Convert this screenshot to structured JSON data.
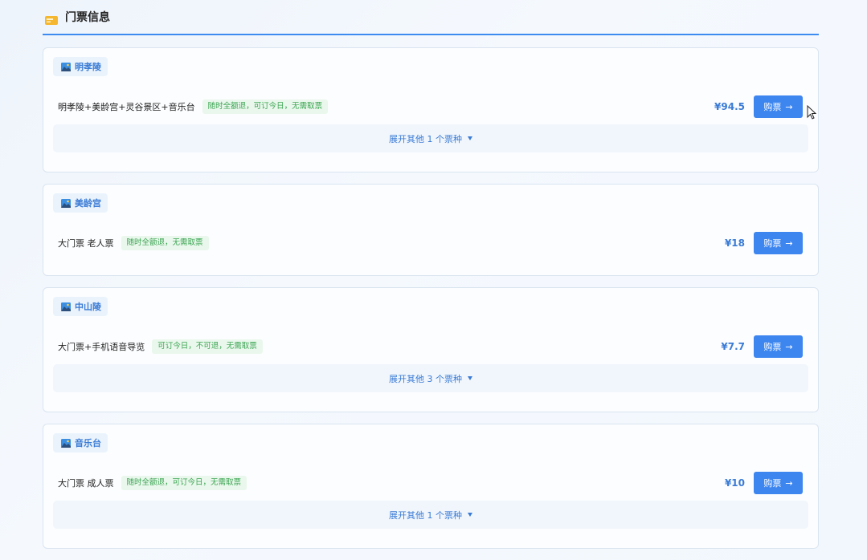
{
  "section": {
    "title": "门票信息",
    "icon": "ticket-icon",
    "accent": "#3d8bf0"
  },
  "cards": [
    {
      "place": "明孝陵",
      "ticket": "明孝陵+美龄宫+灵谷景区+音乐台",
      "badge": "随时全额退，可订今日，无需取票",
      "price": "¥94.5",
      "buy_label": "购票",
      "expand": "展开其他 1 个票种"
    },
    {
      "place": "美龄宫",
      "ticket": "大门票 老人票",
      "badge": "随时全额退，无需取票",
      "price": "¥18",
      "buy_label": "购票",
      "expand": ""
    },
    {
      "place": "中山陵",
      "ticket": "大门票+手机语音导览",
      "badge": "可订今日，不可退，无需取票",
      "price": "¥7.7",
      "buy_label": "购票",
      "expand": "展开其他 3 个票种"
    },
    {
      "place": "音乐台",
      "ticket": "大门票 成人票",
      "badge": "随时全额退，可订今日，无需取票",
      "price": "¥10",
      "buy_label": "购票",
      "expand": "展开其他 1 个票种"
    }
  ],
  "colors": {
    "primary": "#3d86f0",
    "price": "#3a7bd5",
    "badge_text": "#3aa552"
  }
}
